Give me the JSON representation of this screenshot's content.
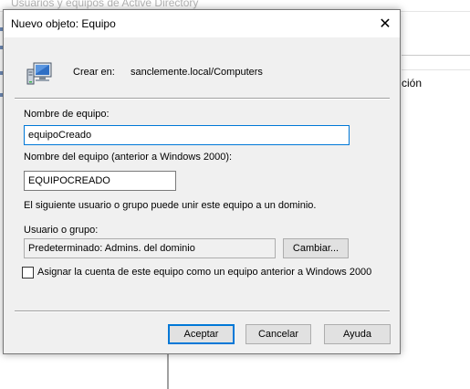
{
  "background_window": {
    "title": "Usuarios y equipos de Active Directory",
    "text_fragment": "ción"
  },
  "dialog": {
    "title": "Nuevo objeto: Equipo",
    "close_glyph": "✕",
    "create_in_label": "Crear en:",
    "create_in_value": "sanclemente.local/Computers",
    "computer_name_label": "Nombre de equipo:",
    "computer_name_value": "equipoCreado",
    "pre2000_label": "Nombre del equipo (anterior a Windows 2000):",
    "pre2000_value": "EQUIPOCREADO",
    "info_text": "El siguiente usuario o grupo puede unir este equipo a un dominio.",
    "user_group_label": "Usuario o grupo:",
    "user_group_value": "Predeterminado: Admins. del dominio",
    "change_button": "Cambiar...",
    "checkbox_label": "Asignar la cuenta de este equipo como un equipo anterior a Windows 2000",
    "checkbox_checked": false,
    "ok_button": "Aceptar",
    "cancel_button": "Cancelar",
    "help_button": "Ayuda"
  },
  "colors": {
    "dialog_bg": "#f0f0f0",
    "focus_accent": "#0078d7",
    "button_bg": "#e1e1e1"
  },
  "icons": {
    "computer": "computer-icon",
    "close": "close-icon"
  }
}
